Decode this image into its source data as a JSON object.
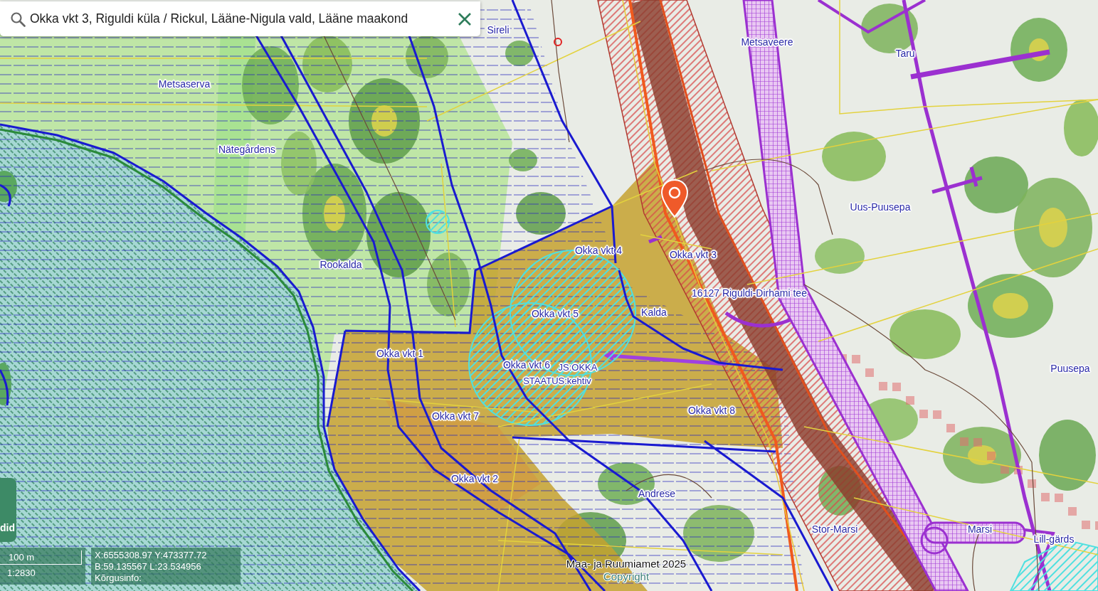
{
  "search": {
    "value": "Okka vkt 3, Riguldi küla / Rickul, Lääne-Nigula vald, Lääne maakond"
  },
  "map": {
    "labels": [
      "Sireli",
      "Metsaveere",
      "Taru",
      "Metsaserva",
      "Nätegårdens",
      "Uus-Puusepa",
      "Okka vkt 4",
      "Okka vkt 3",
      "Rookalda",
      "16127 Riguldi-Dirhami tee",
      "Kalda",
      "Okka vkt 5",
      "Okka vkt 1",
      "Okka vkt 6",
      "JS:OKKA",
      "Puusepa",
      "STAATUS:kehtiv",
      "Okka vkt 8",
      "Okka vkt 7",
      "Okka vkt 2",
      "Andrese",
      "Stor-Marsi",
      "Marsi",
      "Lill-gärds"
    ]
  },
  "layers_button": {
    "label": "did"
  },
  "scale": {
    "distance": "100 m",
    "ratio": "1:2830"
  },
  "coordinates": {
    "lines": [
      "X:6555308.97 Y:473377.72",
      "B:59.135567 L:23.534956",
      "Kõrgusinfo:"
    ]
  },
  "attribution": {
    "text": "Maa- ja Ruumiamet 2025",
    "link": "Copyright"
  }
}
